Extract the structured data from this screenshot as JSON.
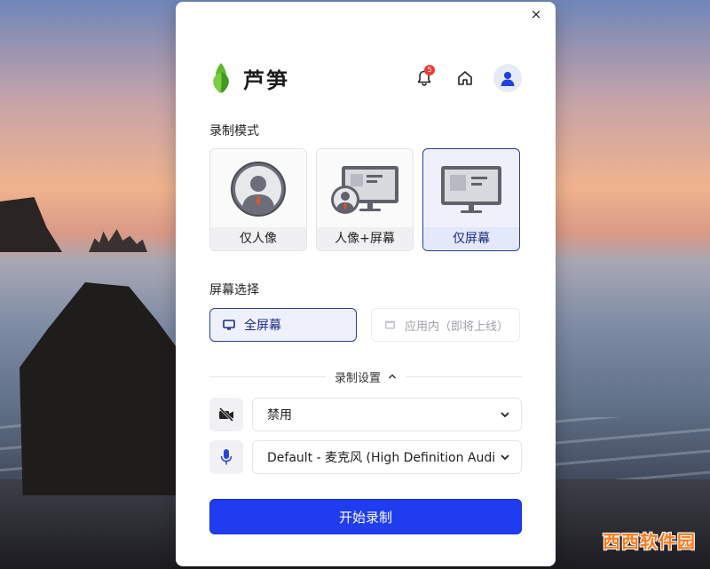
{
  "dialog": {
    "close_label": "×",
    "brand": "芦笋",
    "notification_count": "5"
  },
  "mode": {
    "section_label": "录制模式",
    "options": [
      {
        "label": "仅人像",
        "icon": "portrait-icon"
      },
      {
        "label": "人像+屏幕",
        "icon": "portrait-screen-icon"
      },
      {
        "label": "仅屏幕",
        "icon": "screen-only-icon"
      }
    ],
    "selected": "仅屏幕"
  },
  "screen": {
    "section_label": "屏幕选择",
    "options": [
      {
        "label": "全屏幕",
        "state": "selected"
      },
      {
        "label": "应用内（即将上线）",
        "state": "disabled"
      }
    ]
  },
  "settings": {
    "toggle_label": "录制设置",
    "camera": {
      "value": "禁用",
      "icon": "camera-off-icon"
    },
    "microphone": {
      "value": "Default - 麦克风 (High Definition Audio Device)",
      "icon": "microphone-icon"
    }
  },
  "actions": {
    "start_label": "开始录制"
  },
  "watermark": "西西软件园",
  "colors": {
    "accent": "#1f3cf0",
    "selected_border": "#2b3ca8",
    "selected_bg": "#eef0fc",
    "badge": "#ee3b3b"
  }
}
